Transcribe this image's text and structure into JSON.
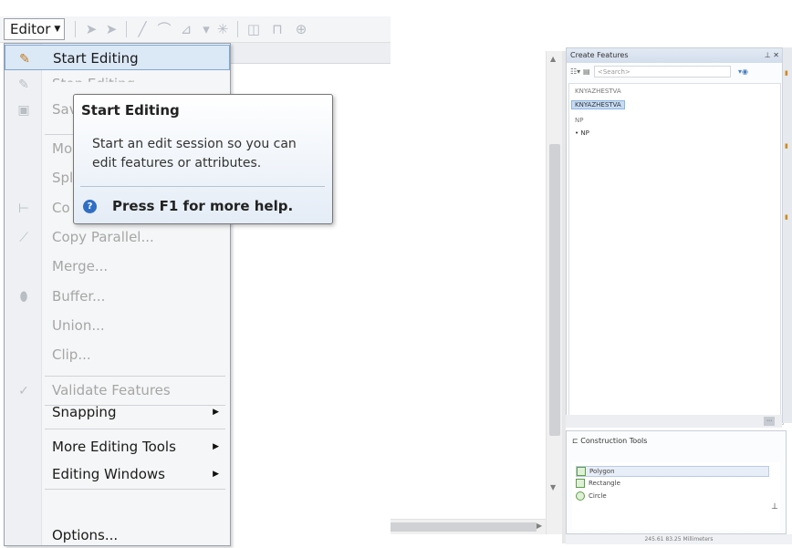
{
  "toolbar": {
    "editor_label": "Editor"
  },
  "menu": {
    "items": [
      {
        "label": "Start Editing",
        "icon": "pencil-icon"
      },
      {
        "label": "Stop Editing",
        "icon": "stop-edit-icon"
      },
      {
        "label": "Save Edits",
        "icon": "save-icon"
      },
      {
        "label": "Move...",
        "icon": ""
      },
      {
        "label": "Split...",
        "icon": ""
      },
      {
        "label": "Construct Points...",
        "icon": "construct-points-icon"
      },
      {
        "label": "Copy Parallel...",
        "icon": "copy-parallel-icon"
      },
      {
        "label": "Merge...",
        "icon": ""
      },
      {
        "label": "Buffer...",
        "icon": "buffer-icon"
      },
      {
        "label": "Union...",
        "icon": ""
      },
      {
        "label": "Clip...",
        "icon": ""
      },
      {
        "label": "Validate Features",
        "icon": "validate-icon"
      },
      {
        "label": "Snapping",
        "icon": ""
      },
      {
        "label": "More Editing Tools",
        "icon": ""
      },
      {
        "label": "Editing Windows",
        "icon": ""
      },
      {
        "label": "Options...",
        "icon": ""
      }
    ],
    "visible": {
      "start": "Start Editing",
      "stop": "Stop Editing",
      "save": "Sav",
      "move": "Mo",
      "split": "Spl",
      "construct": "Co",
      "copy_parallel": "Copy Parallel...",
      "merge": "Merge...",
      "buffer": "Buffer...",
      "union": "Union...",
      "clip": "Clip...",
      "validate": "Validate Features",
      "snapping": "Snapping",
      "more_tools": "More Editing Tools",
      "windows": "Editing Windows",
      "options": "Options..."
    }
  },
  "tooltip": {
    "title": "Start Editing",
    "body": "Start an edit session so you can edit features or attributes.",
    "help": "Press F1 for more help."
  },
  "create_features": {
    "title": "Create Features",
    "search_placeholder": "<Search>",
    "groups": [
      "KNYAZHESTVA",
      "KNYAZHESTVA"
    ],
    "groups2": [
      "NP",
      "NP"
    ]
  },
  "construction_tools": {
    "title": "Construction Tools",
    "items": [
      "Polygon",
      "Rectangle",
      "Circle"
    ]
  },
  "status": {
    "coords": "245.61  83.25 Millimeters"
  },
  "colors": {
    "highlight": "#dbe8f6",
    "highlight_border": "#7fa8d8",
    "disabled_text": "#a6a6a6",
    "help_icon": "#2f6ec4"
  }
}
